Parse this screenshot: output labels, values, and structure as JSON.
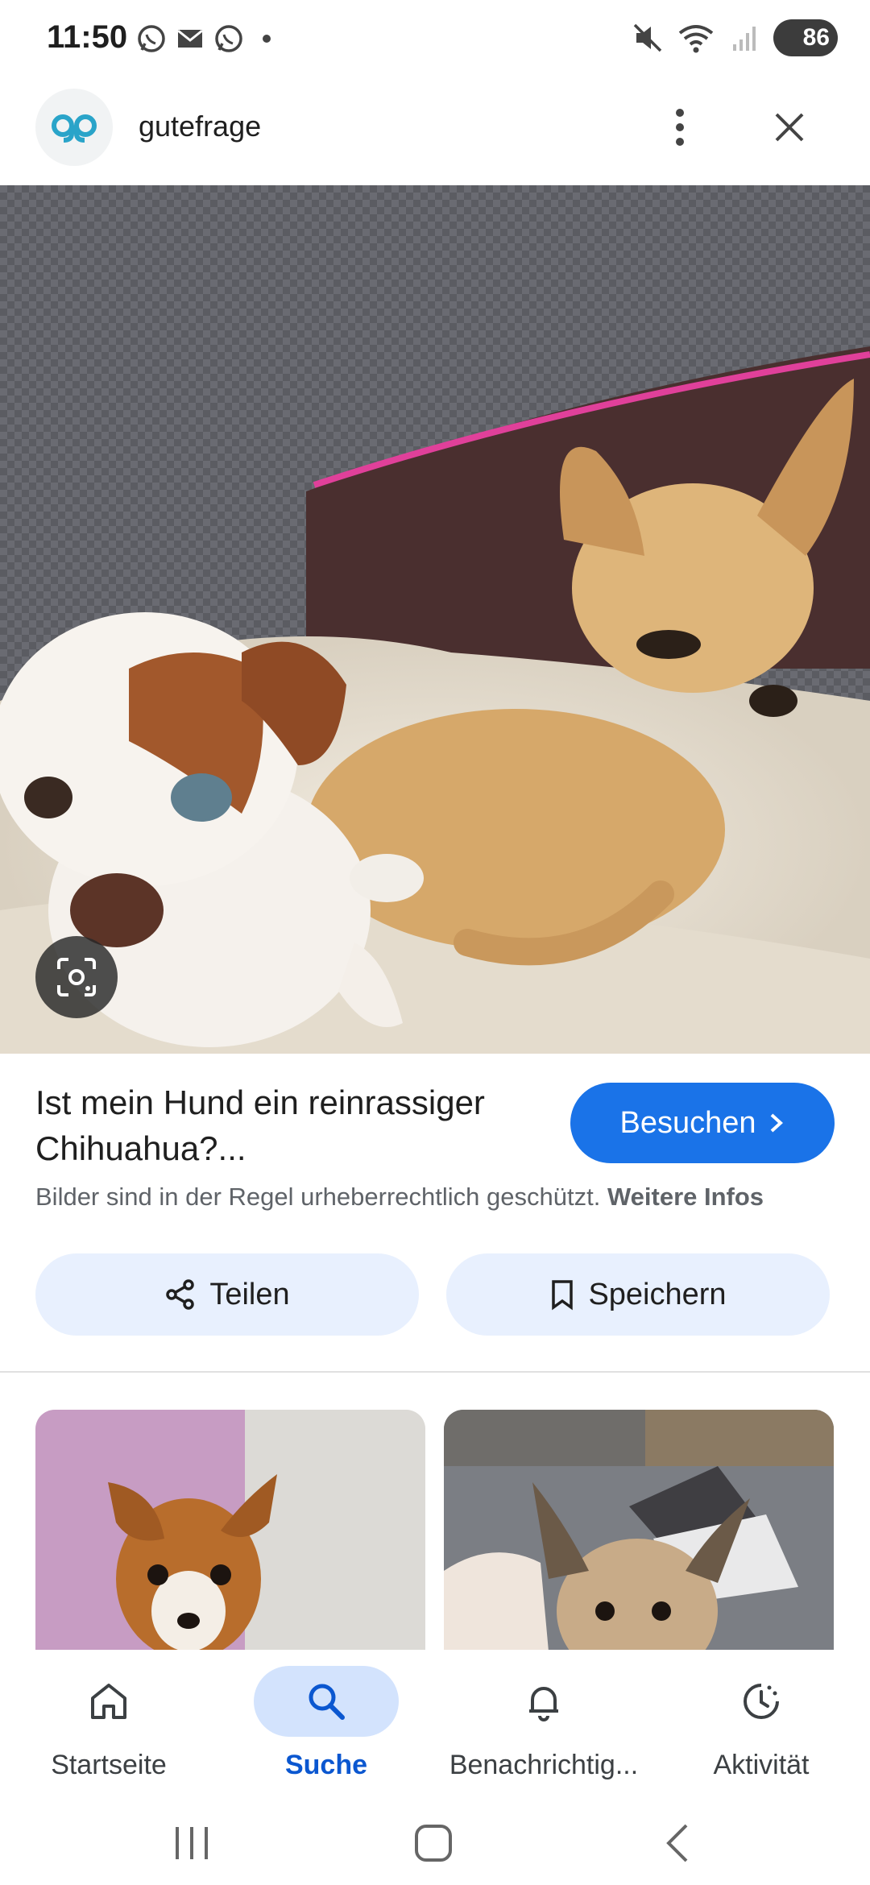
{
  "status_bar": {
    "time": "11:50",
    "notification_icons": [
      "whatsapp-icon",
      "mail-icon",
      "whatsapp-icon"
    ],
    "battery": "86"
  },
  "app_bar": {
    "site_name": "gutefrage"
  },
  "result": {
    "title": "Ist mein Hund ein reinrassiger Chihuahua?...",
    "visit_label": "Besuchen",
    "copyright_text": "Bilder sind in der Regel urheberrechtlich geschützt.",
    "more_info_link": "Weitere Infos",
    "share_label": "Teilen",
    "save_label": "Speichern"
  },
  "colors": {
    "accent": "#1a73e8",
    "pill_bg": "#e8f0fe",
    "nav_active_bg": "#d3e3fd",
    "nav_active_text": "#0b57d0"
  },
  "bottom_nav": {
    "items": [
      {
        "label": "Startseite",
        "icon": "home-icon",
        "active": false
      },
      {
        "label": "Suche",
        "icon": "search-icon",
        "active": true
      },
      {
        "label": "Benachrichtig...",
        "icon": "bell-icon",
        "active": false
      },
      {
        "label": "Aktivität",
        "icon": "activity-icon",
        "active": false
      }
    ]
  }
}
